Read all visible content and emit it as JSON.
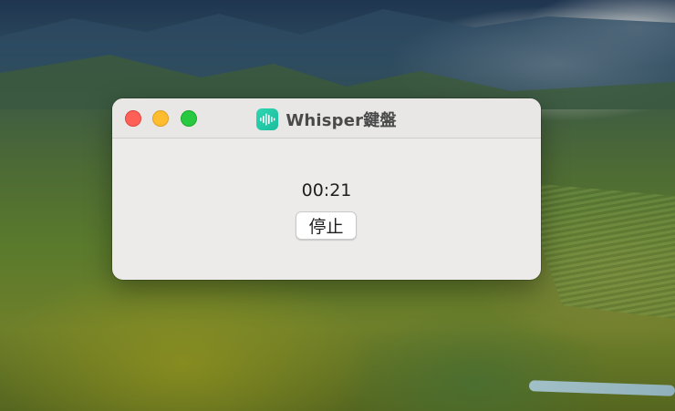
{
  "window": {
    "title": "Whisper鍵盤",
    "app_icon": "waveform-icon",
    "controls": {
      "close": "close-button",
      "minimize": "minimize-button",
      "zoom": "zoom-button"
    }
  },
  "recording": {
    "elapsed_time": "00:21",
    "stop_label": "停止"
  },
  "colors": {
    "window_bg": "#ecebea",
    "titlebar_bg": "#e8e7e6",
    "app_icon_accent": "#2fd6b4",
    "close": "#fe5f57",
    "minimize": "#febc2e",
    "zoom": "#28c840"
  }
}
